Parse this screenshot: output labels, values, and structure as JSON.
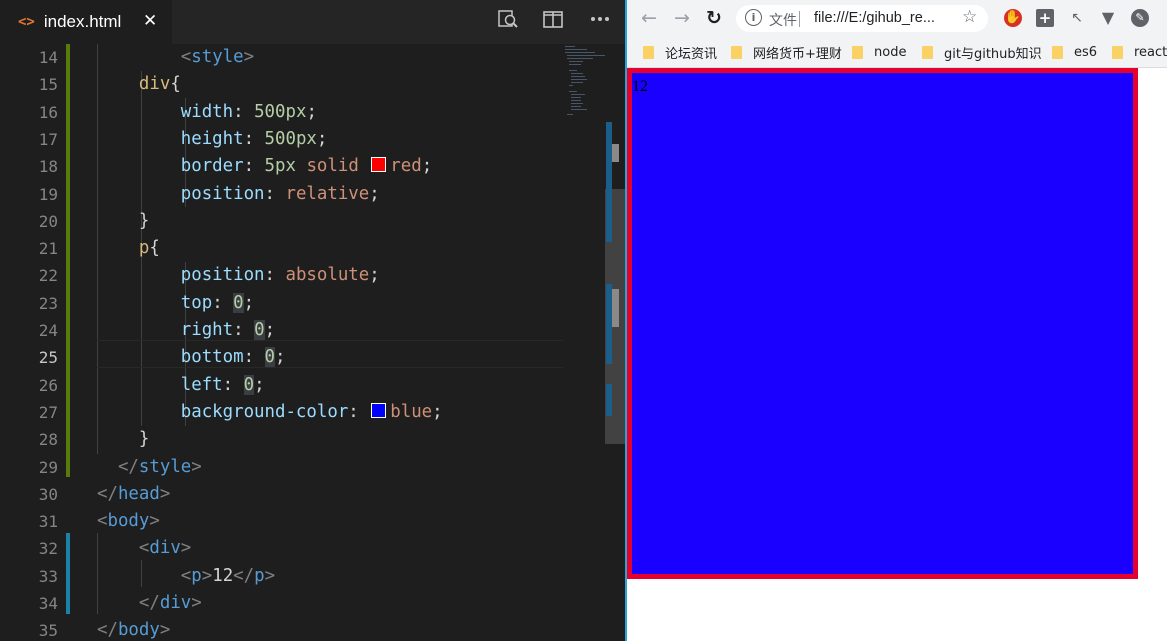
{
  "editor": {
    "tab": {
      "label": "index.html",
      "icon": "code-brackets-icon",
      "close": "✕"
    },
    "actions": [
      "search-preview-icon",
      "split-editor-icon",
      "more-actions-icon"
    ],
    "lines": [
      {
        "num": "14"
      },
      {
        "num": "15"
      },
      {
        "num": "16"
      },
      {
        "num": "17"
      },
      {
        "num": "18"
      },
      {
        "num": "19"
      },
      {
        "num": "20"
      },
      {
        "num": "21"
      },
      {
        "num": "22"
      },
      {
        "num": "23"
      },
      {
        "num": "24"
      },
      {
        "num": "25"
      },
      {
        "num": "26"
      },
      {
        "num": "27"
      },
      {
        "num": "28"
      },
      {
        "num": "29"
      },
      {
        "num": "30"
      },
      {
        "num": "31"
      },
      {
        "num": "32"
      },
      {
        "num": "33"
      },
      {
        "num": "34"
      },
      {
        "num": "35"
      }
    ],
    "active_line": "25",
    "code": {
      "l14": {
        "open": "<",
        "tag": "style",
        "close": ">"
      },
      "l15": {
        "sel": "div",
        "brace": "{"
      },
      "l16": {
        "prop": "width",
        "colon": ": ",
        "val": "500px",
        "semi": ";"
      },
      "l17": {
        "prop": "height",
        "colon": ": ",
        "val": "500px",
        "semi": ";"
      },
      "l18": {
        "prop": "border",
        "colon": ": ",
        "num": "5px",
        "kw": " solid ",
        "color": "red",
        "semi": ";"
      },
      "l19": {
        "prop": "position",
        "colon": ": ",
        "val": "relative",
        "semi": ";"
      },
      "l20": {
        "brace": "}"
      },
      "l21": {
        "sel": "p",
        "brace": "{"
      },
      "l22": {
        "prop": "position",
        "colon": ": ",
        "val": "absolute",
        "semi": ";"
      },
      "l23": {
        "prop": "top",
        "colon": ": ",
        "val": "0",
        "semi": ";"
      },
      "l24": {
        "prop": "right",
        "colon": ": ",
        "val": "0",
        "semi": ";"
      },
      "l25": {
        "prop": "bottom",
        "colon": ": ",
        "val": "0",
        "semi": ";"
      },
      "l26": {
        "prop": "left",
        "colon": ": ",
        "val": "0",
        "semi": ";"
      },
      "l27": {
        "prop": "background-color",
        "colon": ": ",
        "color": "blue",
        "semi": ";"
      },
      "l28": {
        "brace": "}"
      },
      "l29": {
        "open": "</",
        "tag": "style",
        "close": ">"
      },
      "l30": {
        "open": "</",
        "tag": "head",
        "close": ">"
      },
      "l31": {
        "open": "<",
        "tag": "body",
        "close": ">"
      },
      "l32": {
        "open": "<",
        "tag": "div",
        "close": ">"
      },
      "l33": {
        "open": "<",
        "tag": "p",
        "close": ">",
        "text": "12",
        "open2": "</",
        "tag2": "p",
        "close2": ">"
      },
      "l34": {
        "open": "</",
        "tag": "div",
        "close": ">"
      },
      "l35": {
        "open": "</",
        "tag": "body",
        "close": ">"
      }
    },
    "swatch_colors": {
      "red": "#ff0000",
      "blue": "#0000ff"
    }
  },
  "browser": {
    "nav": {
      "back": "←",
      "forward": "→",
      "reload": "↻"
    },
    "omnibox": {
      "label": "文件",
      "url": "file:///E:/gihub_re...",
      "star": "☆"
    },
    "extensions": [
      "shield-extension-icon",
      "plus-extension-icon",
      "cursor-extension-icon",
      "vue-extension-icon",
      "compass-extension-icon"
    ],
    "bookmarks": [
      {
        "label": "论坛资讯"
      },
      {
        "label": "网络货币+理财"
      },
      {
        "label": "node"
      },
      {
        "label": "git与github知识"
      },
      {
        "label": "es6"
      },
      {
        "label": "react"
      }
    ],
    "page": {
      "p_text": "12"
    },
    "page_colors": {
      "border": "#e6002d",
      "background": "#1a00ff"
    }
  }
}
